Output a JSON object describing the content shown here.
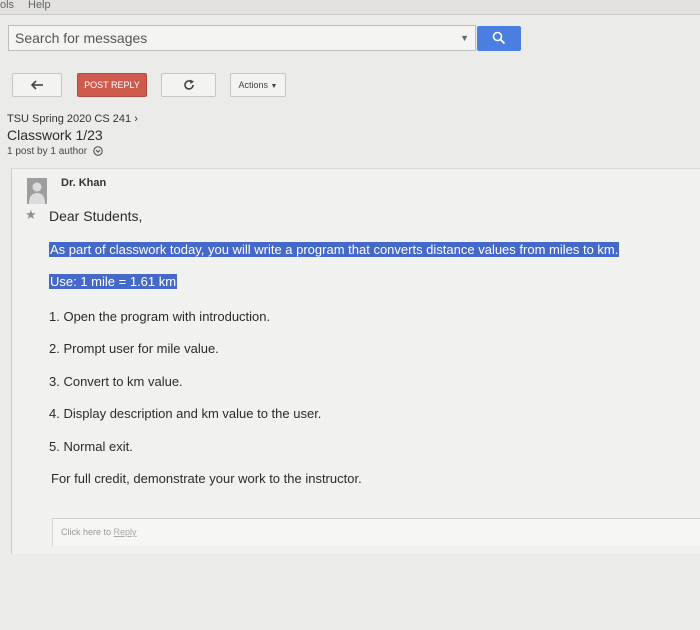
{
  "menubar": {
    "items": [
      "ols",
      "Help"
    ]
  },
  "search": {
    "placeholder": "Search for messages"
  },
  "toolbar": {
    "post_reply": "POST REPLY",
    "actions": "Actions"
  },
  "topic": {
    "group": "TSU Spring 2020 CS 241",
    "title": "Classwork 1/23",
    "post_info": "1 post by 1 author"
  },
  "post": {
    "author": "Dr. Khan",
    "greeting": "Dear Students,",
    "line1": "As part of classwork today, you will write a program that converts distance values from miles to km.",
    "line2": "Use: 1 mile = 1.61 km",
    "steps": [
      "1. Open the program with introduction.",
      "2. Prompt user for mile value.",
      "3. Convert to km value.",
      "4. Display description and km value to the user.",
      "5. Normal exit."
    ],
    "closing": "For full credit, demonstrate your work to the instructor."
  },
  "reply": {
    "prefix": "Click here to",
    "link": "Reply"
  }
}
